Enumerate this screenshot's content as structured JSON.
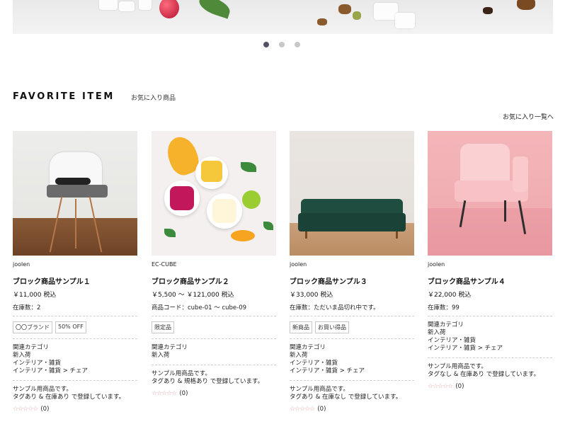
{
  "slider": {
    "dots": [
      true,
      false,
      false
    ]
  },
  "section": {
    "title": "FAVORITE ITEM",
    "subtitle": "お気に入り商品",
    "see_all": "お気に入り一覧へ"
  },
  "products": [
    {
      "brand": "joolen",
      "name": "ブロック商品サンプル１",
      "price": "￥11,000 税込",
      "info": "在庫数：2",
      "tags": [
        "〇〇ブランド",
        "50% OFF"
      ],
      "categories": [
        "関連カテゴリ",
        "新入荷",
        "インテリア・雑貨",
        "インテリア・雑貨 > チェア"
      ],
      "description": [
        "サンプル用商品です。",
        "タグあり & 在庫あり で登録しています。"
      ],
      "rating": "(0)"
    },
    {
      "brand": "EC-CUBE",
      "name": "ブロック商品サンプル２",
      "price": "￥5,500 ～ ￥121,000 税込",
      "info": "商品コード：cube-01 ～ cube-09",
      "tags": [
        "限定品"
      ],
      "categories": [
        "関連カテゴリ",
        "新入荷"
      ],
      "description": [
        "サンプル用商品です。",
        "タグあり & 規格あり で登録しています。"
      ],
      "rating": "(0)"
    },
    {
      "brand": "joolen",
      "name": "ブロック商品サンプル３",
      "price": "￥33,000 税込",
      "info": "在庫数：ただいま品切れ中です。",
      "tags": [
        "新商品",
        "お買い得品"
      ],
      "categories": [
        "関連カテゴリ",
        "新入荷",
        "インテリア・雑貨",
        "インテリア・雑貨 > チェア"
      ],
      "description": [
        "サンプル用商品です。",
        "タグあり & 在庫なし で登録しています。"
      ],
      "rating": "(0)"
    },
    {
      "brand": "joolen",
      "name": "ブロック商品サンプル４",
      "price": "￥22,000 税込",
      "info": "在庫数：99",
      "tags": [],
      "categories": [
        "関連カテゴリ",
        "新入荷",
        "インテリア・雑貨",
        "インテリア・雑貨 > チェア"
      ],
      "description": [
        "サンプル用商品です。",
        "タグなし & 在庫あり で登録しています。"
      ],
      "rating": "(0)"
    }
  ],
  "stars": "☆☆☆☆☆",
  "colors": {
    "dot_active": "#525263",
    "dot_inactive": "#c8c8c8",
    "stars": "#e3a2a2"
  }
}
